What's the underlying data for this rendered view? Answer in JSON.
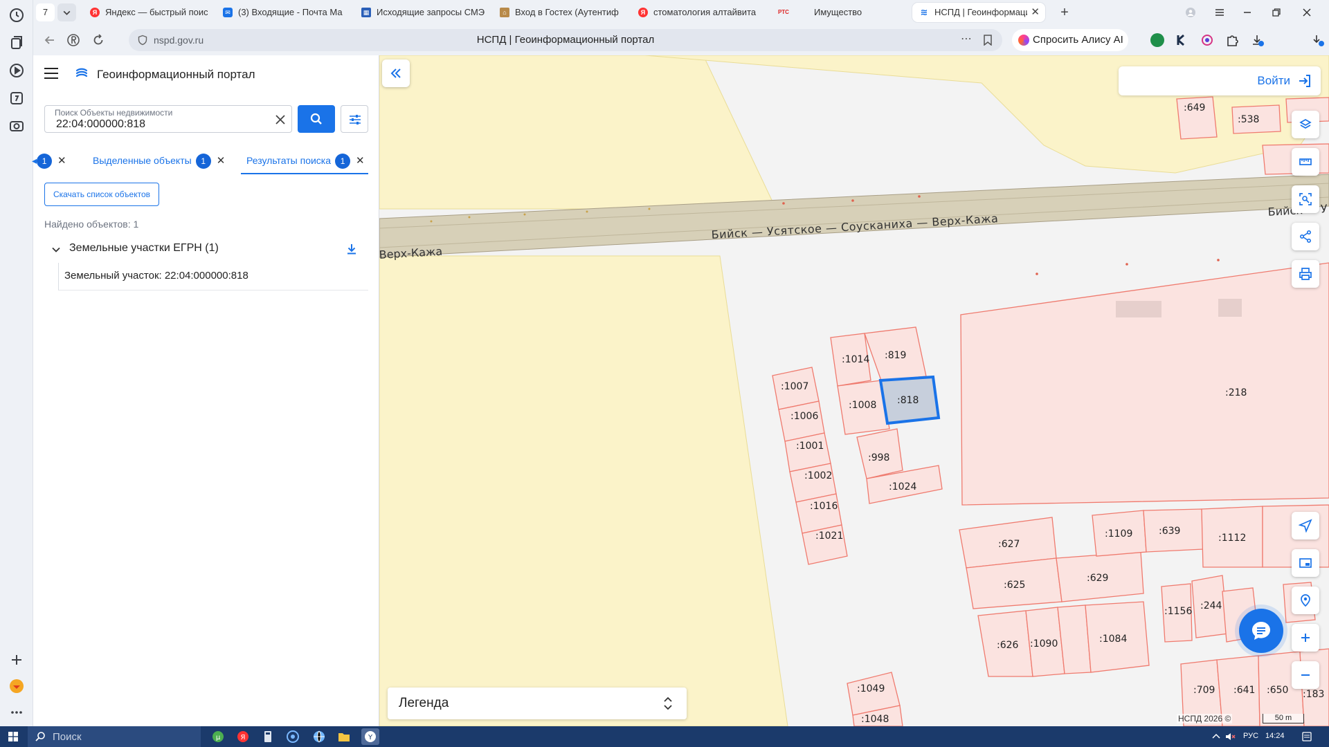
{
  "browser": {
    "tab_count": "7",
    "tabs": [
      {
        "title": "Яндекс — быстрый поиск",
        "icon": "yandex-icon",
        "color": "#ff3333"
      },
      {
        "title": "(3) Входящие - Почта Ма",
        "icon": "mail-icon",
        "color": "#1a73e8"
      },
      {
        "title": "Исходящие запросы СМЭ",
        "icon": "grid-icon",
        "color": "#2a5fb8"
      },
      {
        "title": "Вход в Гостех (Аутентиф",
        "icon": "gostech-icon",
        "color": "#8a6d3b"
      },
      {
        "title": "стоматология алтайвита",
        "icon": "yandex-icon",
        "color": "#ff3333"
      },
      {
        "title": "Имущество",
        "icon": "rts-icon",
        "color": "#d22"
      },
      {
        "title": "НСПД | Геоинформаци",
        "icon": "nspd-icon",
        "color": "#1a73e8"
      }
    ],
    "url": "nspd.gov.ru",
    "page_title": "НСПД | Геоинформационный портал",
    "alice_label": "Спросить Алису AI"
  },
  "panel": {
    "app_title": "Геоинформационный портал",
    "search_label": "Поиск Объекты недвижимости",
    "search_value": "22:04:000000:818",
    "tabs": [
      {
        "label": "",
        "count": "1"
      },
      {
        "label": "Выделенные объекты",
        "count": "1"
      },
      {
        "label": "Результаты поиска",
        "count": "1"
      }
    ],
    "download_label": "Скачать список объектов",
    "found_label": "Найдено объектов: 1",
    "group_title": "Земельные участки ЕГРН (1)",
    "item_label": "Земельный участок: 22:04:000000:818"
  },
  "map": {
    "road_label": "Бийск — Усятское — Соусканиха — Верх-Кажа",
    "road_label_left": "Верх-Кажа",
    "road_label_right": "Бийск — У",
    "login_label": "Войти",
    "legend_label": "Легенда",
    "copyright": "НСПД 2026 ©",
    "scale": "50 m",
    "selected_parcel": ":818",
    "parcel_labels": [
      ":649",
      ":538",
      ":1014",
      ":819",
      ":1007",
      ":1008",
      ":818",
      ":1006",
      ":1001",
      ":998",
      ":1002",
      ":1024",
      ":1016",
      ":1021",
      ":218",
      ":627",
      ":1109",
      ":639",
      ":1112",
      ":625",
      ":629",
      ":1156",
      ":244",
      ":626",
      ":1090",
      ":1084",
      ":1049",
      ":1048",
      ":709",
      ":641",
      ":650",
      ":183"
    ],
    "colors": {
      "parcel_stroke": "#ef7a6e",
      "parcel_fill": "#fbe3e0",
      "field": "#fbf3c9",
      "road": "#c8c0a8",
      "selected": "#1a73e8"
    }
  },
  "taskbar": {
    "search_label": "Поиск",
    "lang": "РУС",
    "time": "14:24"
  }
}
